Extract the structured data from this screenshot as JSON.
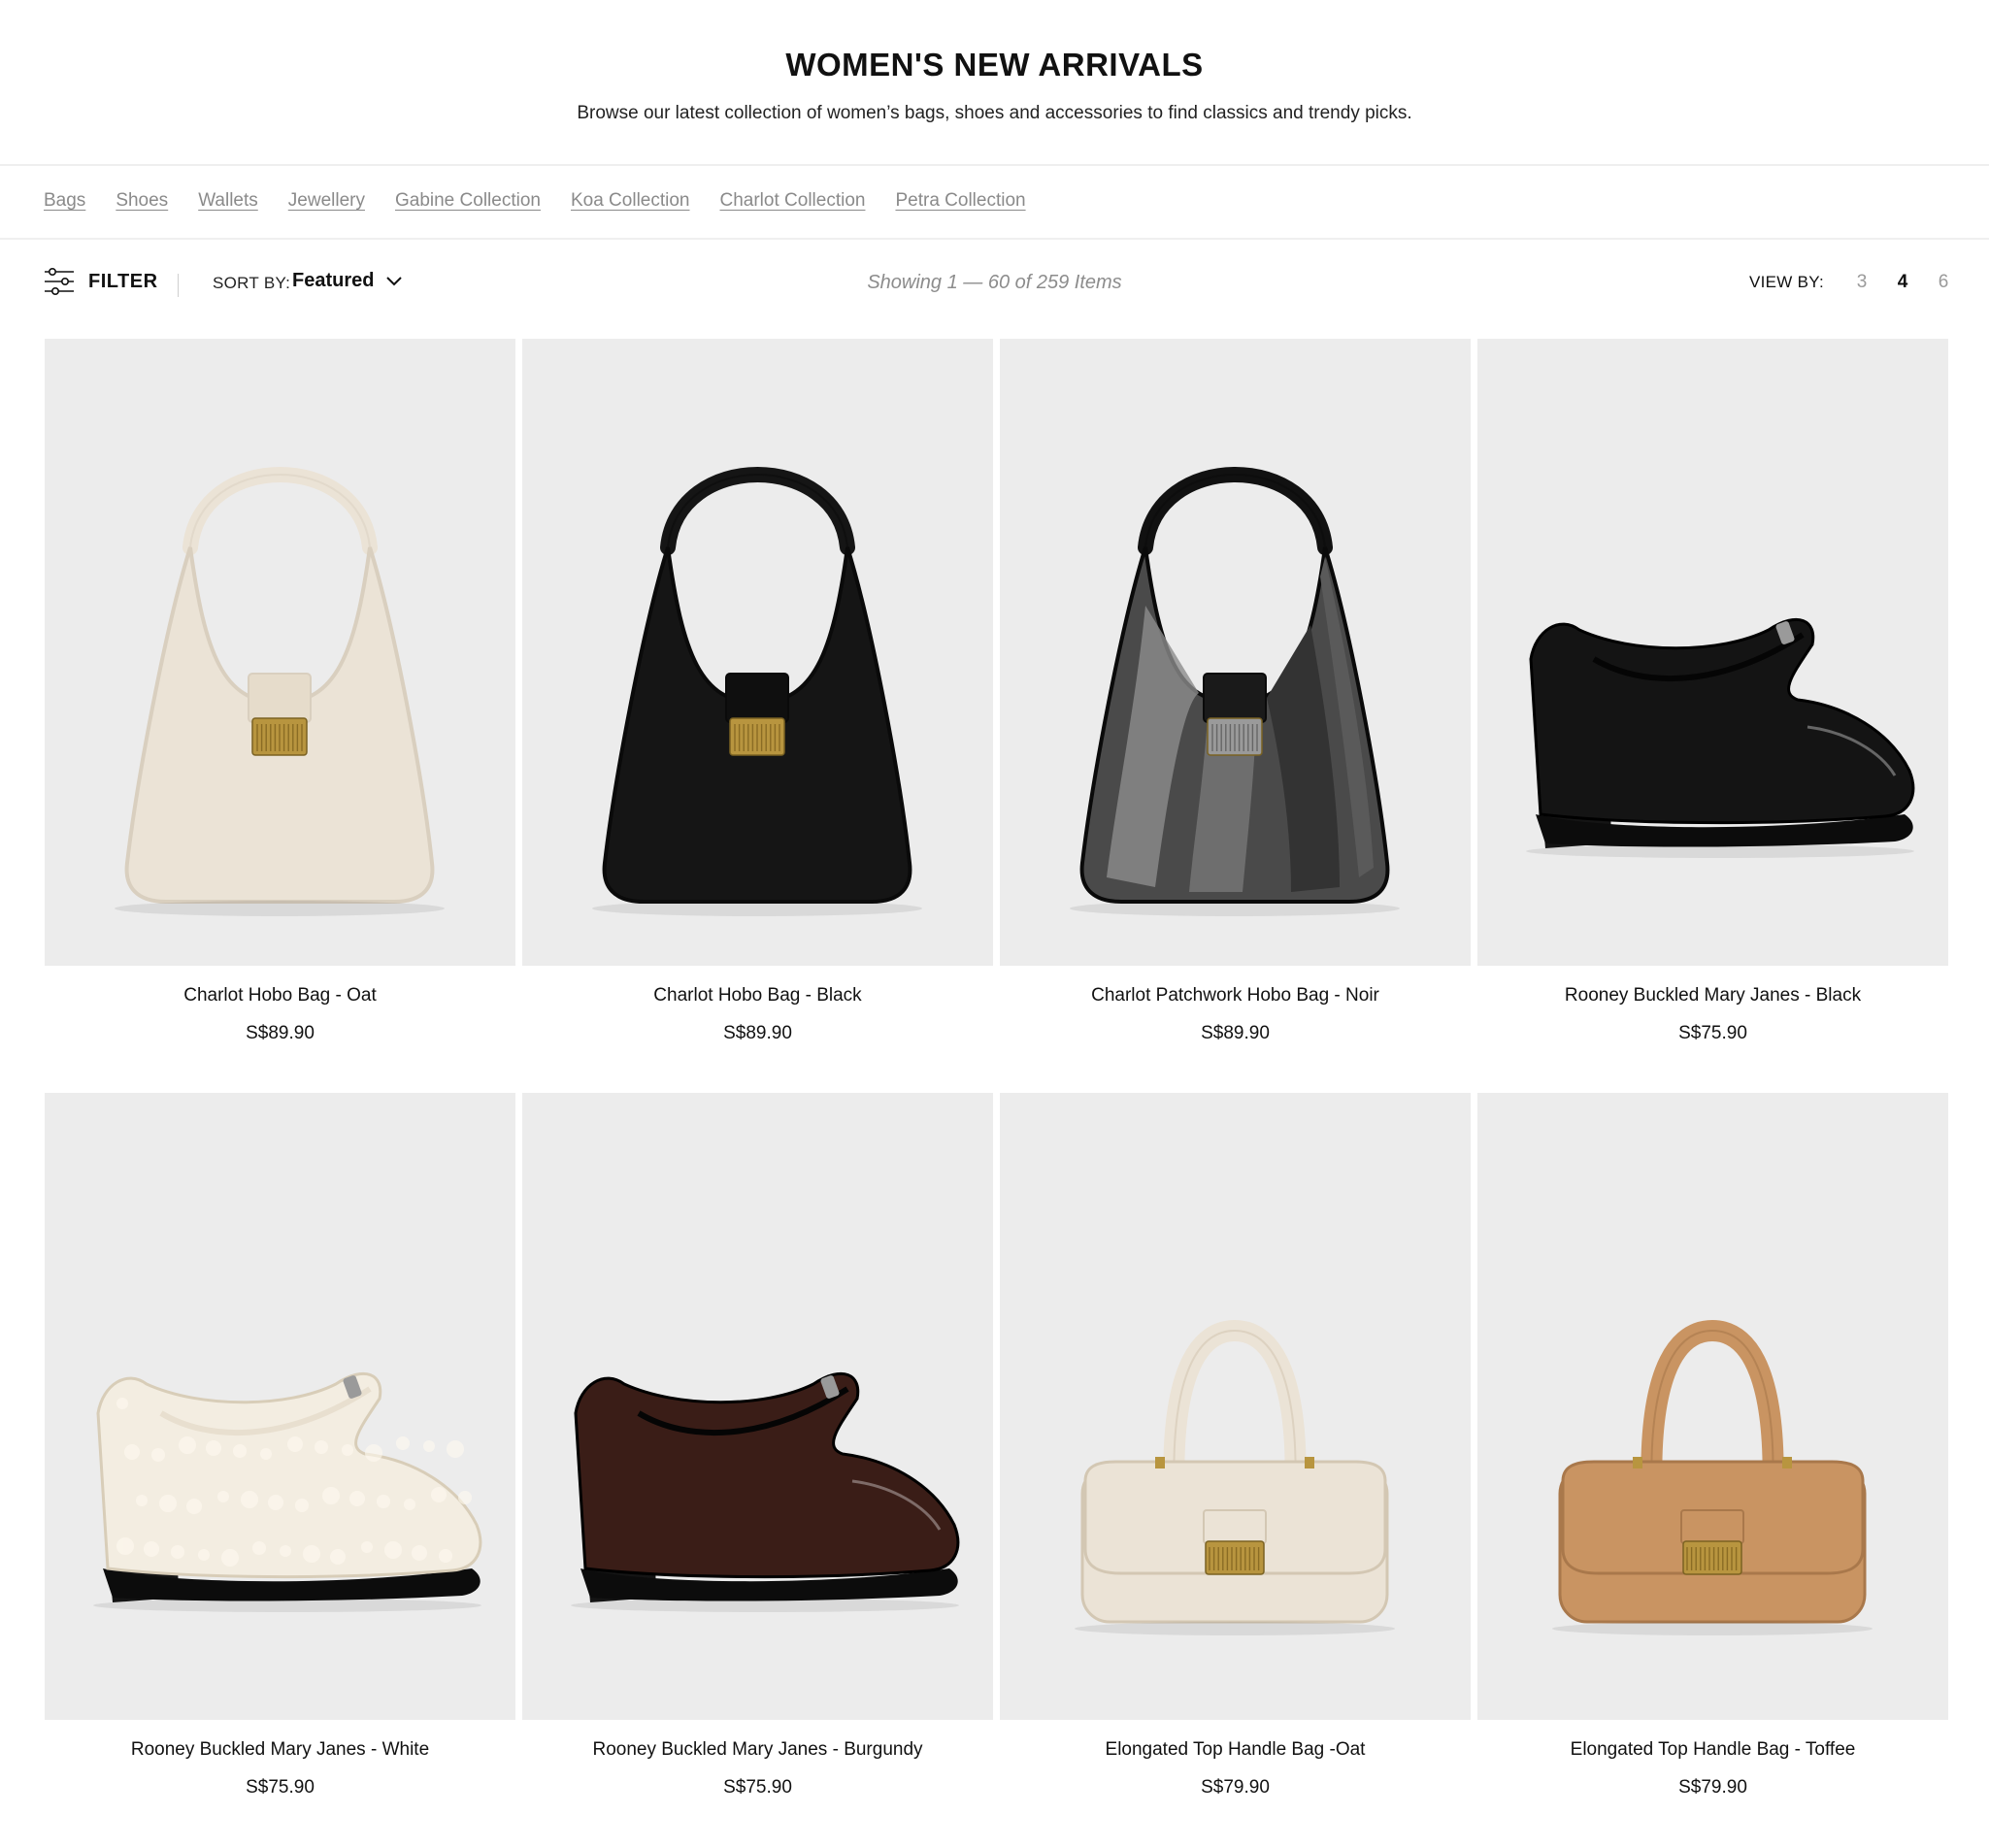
{
  "header": {
    "title": "WOMEN'S NEW ARRIVALS",
    "subtitle": "Browse our latest collection of women’s bags, shoes and accessories to find classics and trendy picks."
  },
  "category_nav": [
    {
      "label": "Bags"
    },
    {
      "label": "Shoes"
    },
    {
      "label": "Wallets"
    },
    {
      "label": "Jewellery"
    },
    {
      "label": "Gabine Collection"
    },
    {
      "label": "Koa Collection"
    },
    {
      "label": "Charlot Collection"
    },
    {
      "label": "Petra Collection"
    }
  ],
  "toolbar": {
    "filter_label": "FILTER",
    "filter_icon": "sliders-icon",
    "sort_label": "SORT BY:",
    "sort_value": "Featured",
    "sort_icon": "chevron-down-icon",
    "results_text": "Showing 1 — 60 of 259 Items",
    "view_label": "VIEW BY:",
    "view_options": [
      "3",
      "4",
      "6"
    ],
    "view_selected": "4"
  },
  "products": [
    {
      "name": "Charlot Hobo Bag - Oat",
      "price": "S$89.90",
      "kind": "hobo",
      "color": "#ebe3d6"
    },
    {
      "name": "Charlot Hobo Bag - Black",
      "price": "S$89.90",
      "kind": "hobo",
      "color": "#151515"
    },
    {
      "name": "Charlot Patchwork Hobo Bag - Noir",
      "price": "S$89.90",
      "kind": "hobo-patch",
      "color": "#4a4a4a"
    },
    {
      "name": "Rooney Buckled Mary Janes - Black",
      "price": "S$75.90",
      "kind": "shoe",
      "color": "#141414"
    },
    {
      "name": "Rooney Buckled Mary Janes - White",
      "price": "S$75.90",
      "kind": "shoe-fur",
      "color": "#f3ede1"
    },
    {
      "name": "Rooney Buckled Mary Janes - Burgundy",
      "price": "S$75.90",
      "kind": "shoe",
      "color": "#3a1d17"
    },
    {
      "name": "Elongated Top Handle Bag -Oat",
      "price": "S$79.90",
      "kind": "top",
      "color": "#ebe3d6"
    },
    {
      "name": "Elongated Top Handle Bag - Toffee",
      "price": "S$79.90",
      "kind": "top",
      "color": "#c99462"
    }
  ],
  "theme": {
    "image_background": "#ececec",
    "hardware_gold": "#b8953f",
    "link_gray": "#8a8a8a"
  }
}
